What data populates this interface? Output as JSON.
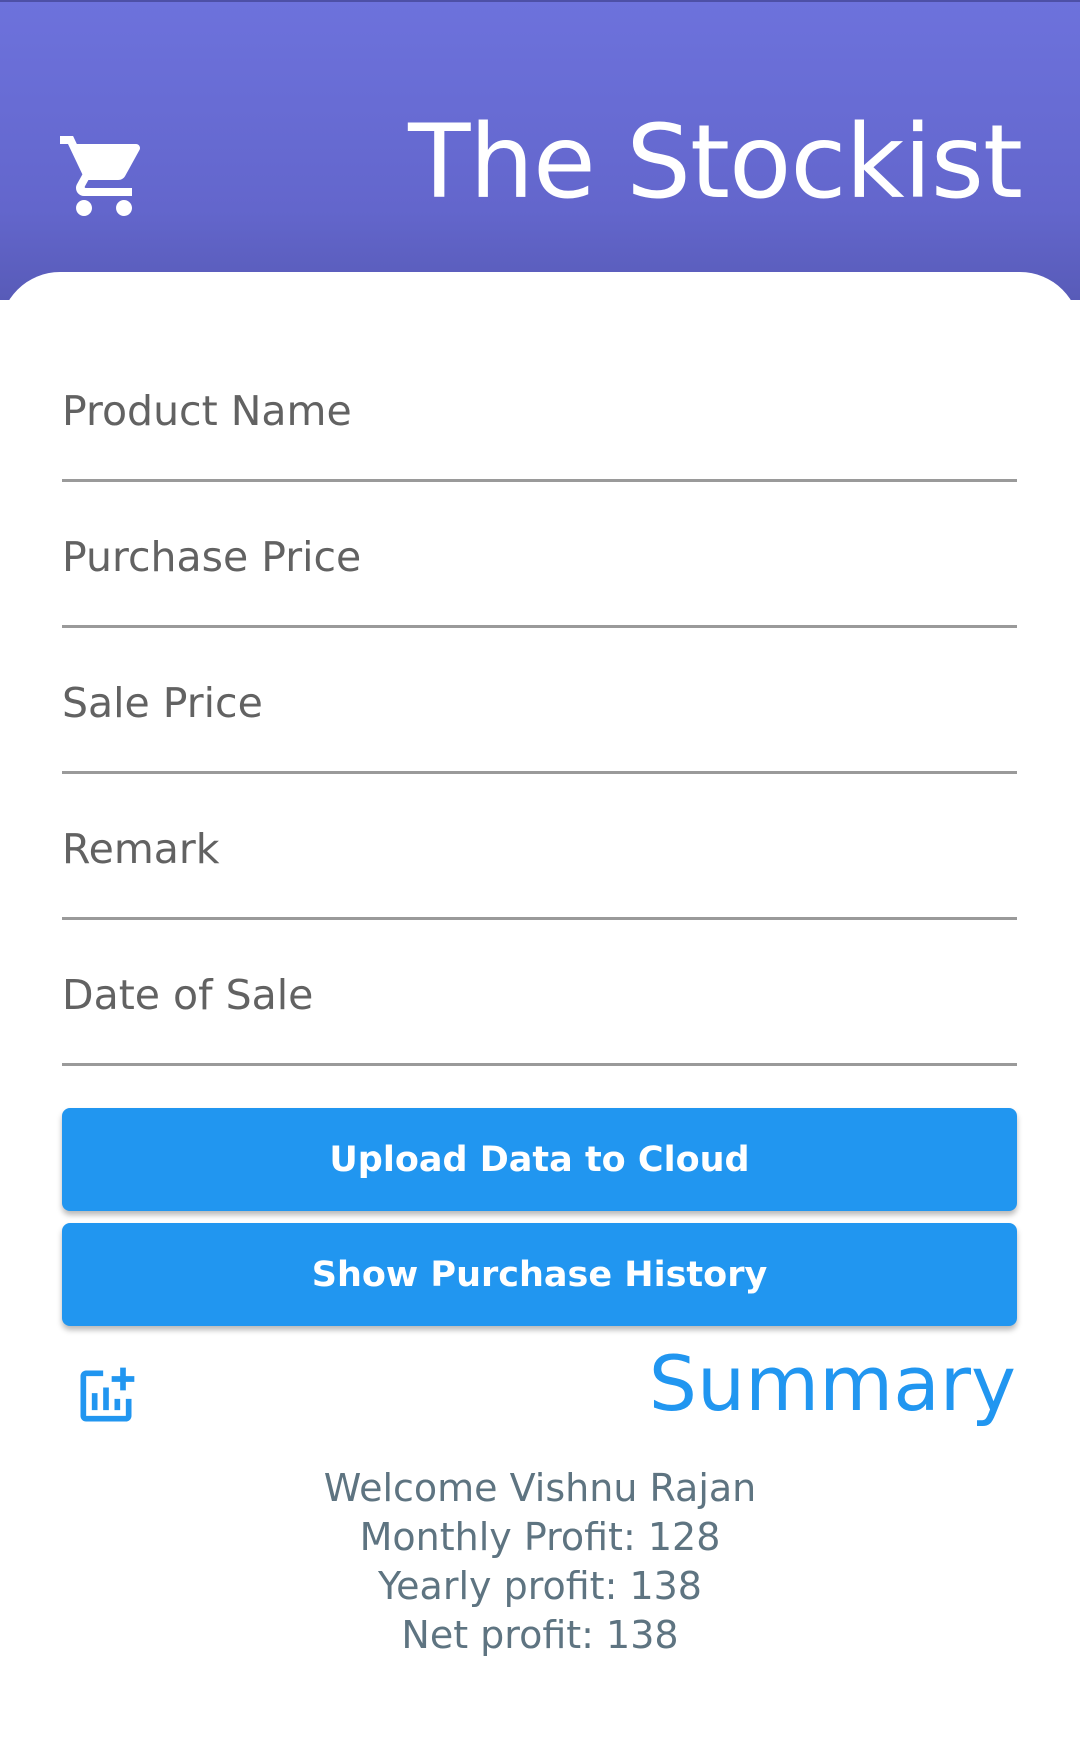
{
  "app": {
    "title": "The Stockist",
    "header_icon": "shopping-cart-icon",
    "colors": {
      "header": "#6d72dc",
      "accent": "#2196f0",
      "summary_text": "#5e7481"
    }
  },
  "form": {
    "fields": [
      {
        "placeholder": "Product Name",
        "value": ""
      },
      {
        "placeholder": "Purchase Price",
        "value": ""
      },
      {
        "placeholder": "Sale Price",
        "value": ""
      },
      {
        "placeholder": "Remark",
        "value": ""
      },
      {
        "placeholder": "Date of Sale",
        "value": ""
      }
    ]
  },
  "actions": {
    "upload_label": "Upload Data to Cloud",
    "history_label": "Show Purchase History"
  },
  "summary": {
    "icon": "add-chart-icon",
    "title": "Summary",
    "welcome": "Welcome Vishnu Rajan",
    "monthly": "Monthly Profit: 128",
    "yearly": "Yearly profit: 138",
    "net": "Net profit: 138"
  }
}
